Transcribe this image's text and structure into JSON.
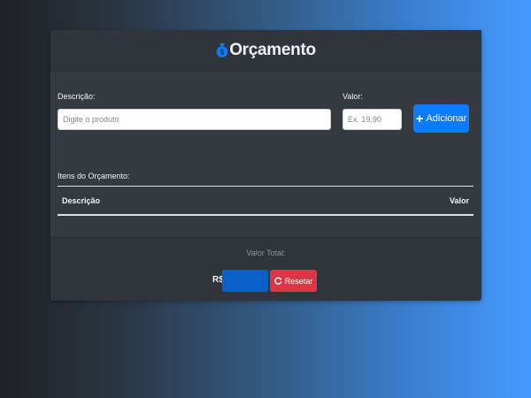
{
  "header": {
    "title": "Orçamento",
    "icon": "money-bag-icon"
  },
  "form": {
    "description_label": "Descrição:",
    "description_placeholder": "Digite o produto",
    "description_value": "",
    "value_label": "Valor:",
    "value_placeholder": "Ex. 19,90",
    "value_value": "",
    "add_button_label": "Adicionar",
    "add_button_icon": "plus-icon"
  },
  "items": {
    "section_label": "Itens do Orçamento:",
    "columns": [
      "Descrição",
      "Valor"
    ],
    "rows": []
  },
  "footer": {
    "total_label": "Valor Total:",
    "currency": "R$",
    "total_value": "",
    "reset_button_label": "Resetar",
    "reset_button_icon": "reset-icon"
  },
  "colors": {
    "primary": "#0d7bff",
    "danger": "#dc3545",
    "card": "#343a40"
  }
}
